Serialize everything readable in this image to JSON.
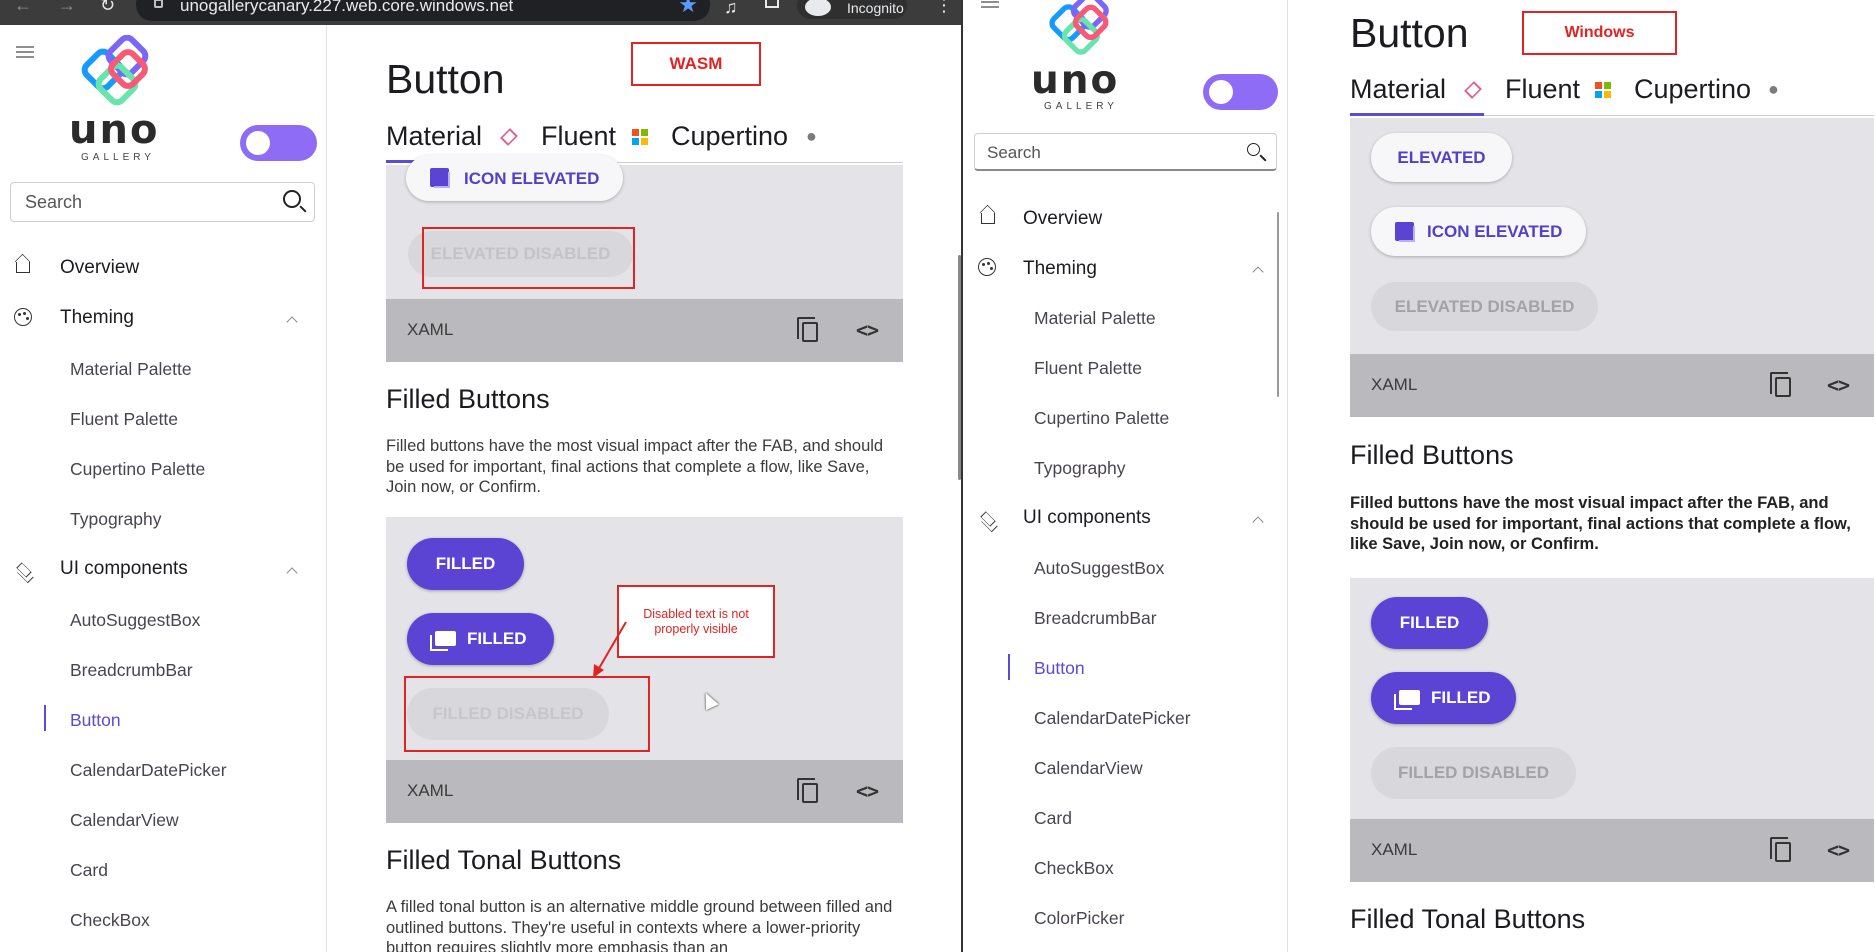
{
  "wasm": {
    "browser": {
      "url": "unogallerycanary.227.web.core.windows.net",
      "incognito_label": "Incognito"
    },
    "logo_word": "uno",
    "logo_sub": "GALLERY",
    "search_placeholder": "Search",
    "nav": {
      "overview": "Overview",
      "theming": "Theming",
      "theming_items": [
        "Material Palette",
        "Fluent Palette",
        "Cupertino Palette",
        "Typography"
      ],
      "ui_components": "UI components",
      "ui_items": [
        "AutoSuggestBox",
        "BreadcrumbBar",
        "Button",
        "CalendarDatePicker",
        "CalendarView",
        "Card",
        "CheckBox"
      ]
    },
    "page_title": "Button",
    "tabs": [
      "Material",
      "Fluent",
      "Cupertino"
    ],
    "platform_label": "WASM",
    "buttons": {
      "icon_elevated": "ICON ELEVATED",
      "elevated_disabled": "ELEVATED DISABLED",
      "filled": "FILLED",
      "filled_icon": "FILLED",
      "filled_disabled": "FILLED DISABLED"
    },
    "xaml_label": "XAML",
    "filled_heading": "Filled Buttons",
    "filled_desc": "Filled buttons have the most visual impact after the FAB, and should be used for important, final actions that complete a flow, like Save, Join now, or Confirm.",
    "tonal_heading": "Filled Tonal Buttons",
    "tonal_desc": "A filled tonal button is an alternative middle ground between filled and outlined buttons. They're useful in contexts where a lower-priority button requires slightly more emphasis than an",
    "callout": "Disabled text is not properly visible"
  },
  "windows": {
    "logo_word": "uno",
    "logo_sub": "GALLERY",
    "search_placeholder": "Search",
    "nav": {
      "overview": "Overview",
      "theming": "Theming",
      "theming_items": [
        "Material Palette",
        "Fluent Palette",
        "Cupertino Palette",
        "Typography"
      ],
      "ui_components": "UI components",
      "ui_items": [
        "AutoSuggestBox",
        "BreadcrumbBar",
        "Button",
        "CalendarDatePicker",
        "CalendarView",
        "Card",
        "CheckBox",
        "ColorPicker"
      ]
    },
    "page_title": "Button",
    "tabs": [
      "Material",
      "Fluent",
      "Cupertino"
    ],
    "platform_label": "Windows",
    "buttons": {
      "elevated": "ELEVATED",
      "icon_elevated": "ICON ELEVATED",
      "elevated_disabled": "ELEVATED DISABLED",
      "filled": "FILLED",
      "filled_icon": "FILLED",
      "filled_disabled": "FILLED DISABLED"
    },
    "xaml_label": "XAML",
    "filled_heading": "Filled Buttons",
    "filled_desc": "Filled buttons have the most visual impact after the FAB, and should be used for important, final actions that complete a flow, like Save, Join now, or Confirm.",
    "tonal_heading": "Filled Tonal Buttons"
  },
  "colors": {
    "accent": "#5b44d4",
    "annotation_red": "#e02424",
    "toggle": "#8e6cf5"
  }
}
